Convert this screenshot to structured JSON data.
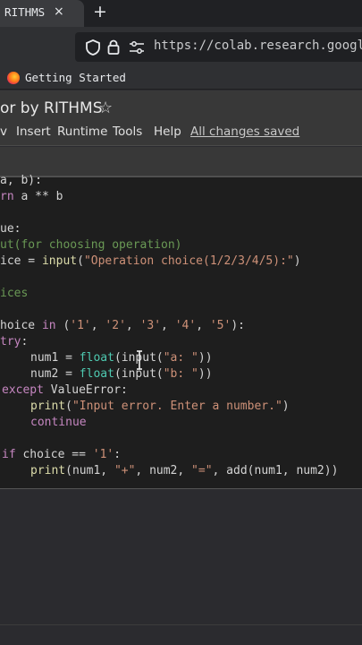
{
  "browser": {
    "tab_title": "y RITHMS",
    "tab_close": "×",
    "new_tab": "+",
    "url": "https://colab.research.google",
    "bookmark": "Getting Started"
  },
  "colab": {
    "notebook_title": "or by RITHMS",
    "star": "☆",
    "menu": [
      "v",
      "Insert",
      "Runtime",
      "Tools",
      "Help"
    ],
    "save_status": "All changes saved"
  },
  "code": {
    "l1a": "a, b):",
    "l2a": "rn",
    "l2b": " a ** b",
    "l3a": "ue:",
    "l4a": "ut(for choosing operation)",
    "l5a": "ice = ",
    "l5b": "input",
    "l5c": "(",
    "l5d": "\"Operation choice(1/2/3/4/5):\"",
    "l5e": ")",
    "l6a": "ices",
    "l7a": "hoice ",
    "l7b": "in",
    "l7c": " (",
    "l7d": "'1'",
    "l7e": ", ",
    "l7f": "'2'",
    "l7g": ", ",
    "l7h": "'3'",
    "l7i": ", ",
    "l7j": "'4'",
    "l7k": ", ",
    "l7l": "'5'",
    "l7m": "):",
    "l8a": "try",
    "l8b": ":",
    "l9a": "num1 = ",
    "l9b": "float",
    "l9c": "(input(",
    "l9d": "\"a: \"",
    "l9e": "))",
    "l10a": "num2 = ",
    "l10b": "float",
    "l10c": "(input(",
    "l10d": "\"b: \"",
    "l10e": "))",
    "l11a": "except",
    "l11b": " ValueError:",
    "l12a": "print",
    "l12b": "(",
    "l12c": "\"Input error. Enter a number.\"",
    "l12d": ")",
    "l13a": "continue",
    "l14a": "if",
    "l14b": " choice == ",
    "l14c": "'1'",
    "l14d": ":",
    "l15a": "print",
    "l15b": "(num1, ",
    "l15c": "\"+\"",
    "l15d": ", num2, ",
    "l15e": "\"=\"",
    "l15f": ", add(num1, num2))"
  },
  "colors": {
    "keyword": "#c586c0",
    "string": "#ce9178",
    "comment": "#6a9955",
    "function": "#dcdcaa"
  }
}
